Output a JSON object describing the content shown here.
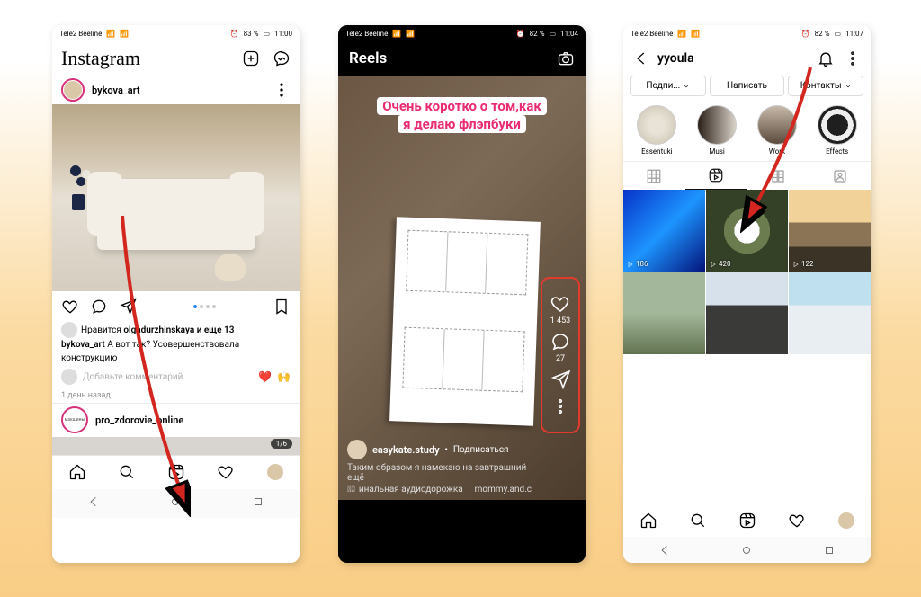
{
  "phone1": {
    "status": {
      "carrier": "Tele2 Beeline",
      "battery": "83 %",
      "time": "11:00"
    },
    "brand": "Instagram",
    "story_user": "bykova_art",
    "likes_line_prefix": "Нравится ",
    "likes_user": "olgadurzhinskaya",
    "likes_suffix": " и еще 13",
    "caption_user": "bykova_art",
    "caption_text": " А вот так? Усовершенствовала конструкцию",
    "comment_placeholder": "Добавьте комментарий...",
    "emoji1": "❤️",
    "emoji2": "🙌",
    "time_ago": "1 день назад",
    "next_story": "pro_zdorovie_online",
    "next_badge": "1/6"
  },
  "phone2": {
    "status": {
      "carrier": "Tele2 Beeline",
      "battery": "82 %",
      "time": "11:04"
    },
    "title": "Reels",
    "caption_l1": "Очень коротко о том,как",
    "caption_l2": "я делаю флэпбуки",
    "likes": "1 453",
    "comments": "27",
    "author": "easykate.study",
    "subscribe": "Подписаться",
    "desc": "Таким образом я намекаю на завтрашний",
    "more": "ещё",
    "audio_prefix": "инальная аудиодорожка",
    "audio_author": "mommy.and.c"
  },
  "phone3": {
    "status": {
      "carrier": "Tele2 Beeline",
      "battery": "82 %",
      "time": "11:07"
    },
    "username": "yyoula",
    "btn_follow": "Подпи...",
    "btn_message": "Написать",
    "btn_contacts": "Контакты",
    "highlights": [
      {
        "label": "Essentuki"
      },
      {
        "label": "Musi"
      },
      {
        "label": "Work"
      },
      {
        "label": "Effects"
      }
    ],
    "reel_views": [
      "186",
      "420",
      "122"
    ]
  }
}
